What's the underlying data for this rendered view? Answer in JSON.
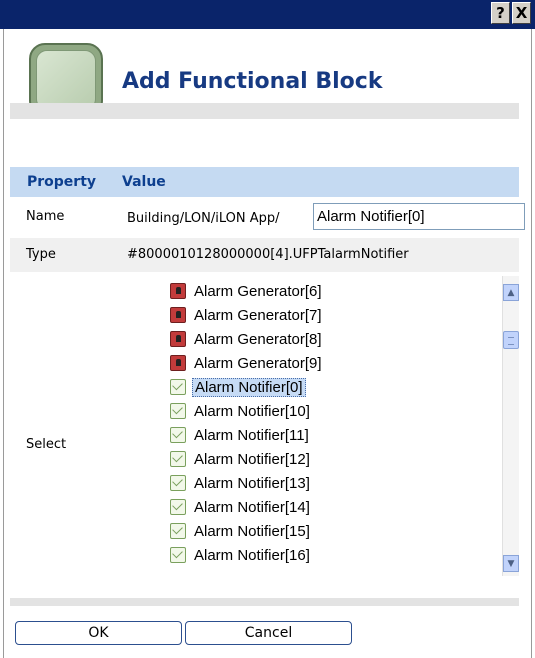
{
  "dialog": {
    "help_button": "?",
    "close_button": "X",
    "title": "Add Functional Block"
  },
  "table": {
    "header_property": "Property",
    "header_value": "Value",
    "name": {
      "label": "Name",
      "prefix": "Building/LON/iLON App/",
      "value": "Alarm Notifier[0]"
    },
    "type": {
      "label": "Type",
      "value": "#8000010128000000[4].UFPTalarmNotifier"
    },
    "select": {
      "label": "Select",
      "items": [
        {
          "label": "Alarm Generator[6]",
          "icon": "alarm-generator-icon"
        },
        {
          "label": "Alarm Generator[7]",
          "icon": "alarm-generator-icon"
        },
        {
          "label": "Alarm Generator[8]",
          "icon": "alarm-generator-icon"
        },
        {
          "label": "Alarm Generator[9]",
          "icon": "alarm-generator-icon"
        },
        {
          "label": "Alarm Notifier[0]",
          "icon": "alarm-notifier-icon",
          "selected": true
        },
        {
          "label": "Alarm Notifier[10]",
          "icon": "alarm-notifier-icon"
        },
        {
          "label": "Alarm Notifier[11]",
          "icon": "alarm-notifier-icon"
        },
        {
          "label": "Alarm Notifier[12]",
          "icon": "alarm-notifier-icon"
        },
        {
          "label": "Alarm Notifier[13]",
          "icon": "alarm-notifier-icon"
        },
        {
          "label": "Alarm Notifier[14]",
          "icon": "alarm-notifier-icon"
        },
        {
          "label": "Alarm Notifier[15]",
          "icon": "alarm-notifier-icon"
        },
        {
          "label": "Alarm Notifier[16]",
          "icon": "alarm-notifier-icon"
        }
      ]
    }
  },
  "buttons": {
    "ok": "OK",
    "cancel": "Cancel"
  },
  "colors": {
    "titlebar": "#0a246a",
    "title_text": "#173a82",
    "header_bg": "#c5daf2",
    "selection": "#c6dbf5"
  }
}
